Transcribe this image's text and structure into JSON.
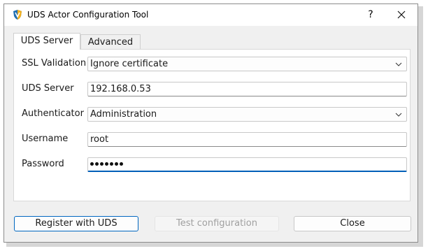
{
  "window": {
    "title": "UDS Actor Configuration Tool",
    "help_glyph": "?",
    "icon": "uds-shield-icon",
    "accent": "#005fb8"
  },
  "tabs": [
    {
      "label": "UDS Server",
      "active": true
    },
    {
      "label": "Advanced",
      "active": false
    }
  ],
  "form": {
    "ssl_validation": {
      "label": "SSL Validation",
      "value": "Ignore certificate"
    },
    "uds_server": {
      "label": "UDS Server",
      "value": "192.168.0.53"
    },
    "authenticator": {
      "label": "Authenticator",
      "value": "Administration"
    },
    "username": {
      "label": "Username",
      "value": "root"
    },
    "password": {
      "label": "Password",
      "masked_length": 7
    }
  },
  "buttons": {
    "register": "Register with UDS",
    "test": "Test configuration",
    "close": "Close"
  }
}
